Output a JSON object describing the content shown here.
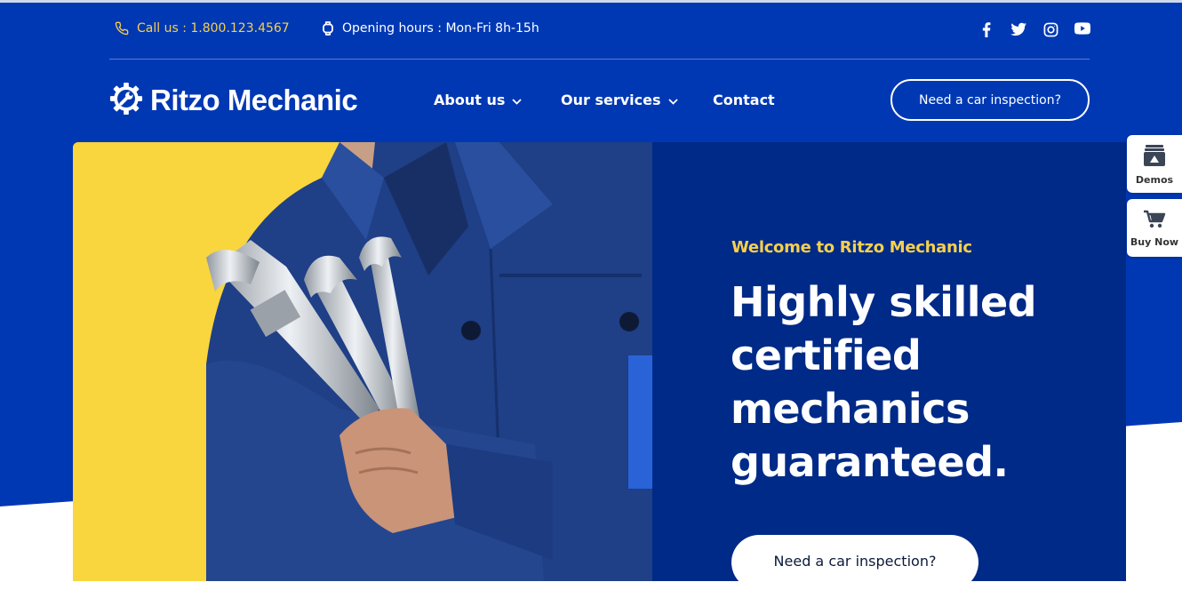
{
  "topbar": {
    "call_text": "Call us : 1.800.123.4567",
    "hours_text": "Opening hours : Mon-Fri 8h-15h",
    "social": [
      "facebook-icon",
      "twitter-icon",
      "instagram-icon",
      "youtube-icon"
    ]
  },
  "nav": {
    "logo_text": "Ritzo Mechanic",
    "items": [
      {
        "label": "About us",
        "dropdown": true
      },
      {
        "label": "Our services",
        "dropdown": true
      },
      {
        "label": "Contact",
        "dropdown": false
      }
    ],
    "cta_label": "Need a car inspection?"
  },
  "hero": {
    "welcome": "Welcome to Ritzo Mechanic",
    "headline": "Highly skilled certified mechanics guaranteed.",
    "cta_label": "Need a car inspection?"
  },
  "side": {
    "demos_label": "Demos",
    "buy_label": "Buy Now"
  },
  "colors": {
    "primary_blue": "#0038b4",
    "panel_blue": "#002a87",
    "accent_yellow": "#f6d04d",
    "hero_bg_yellow": "#f9d53e"
  }
}
